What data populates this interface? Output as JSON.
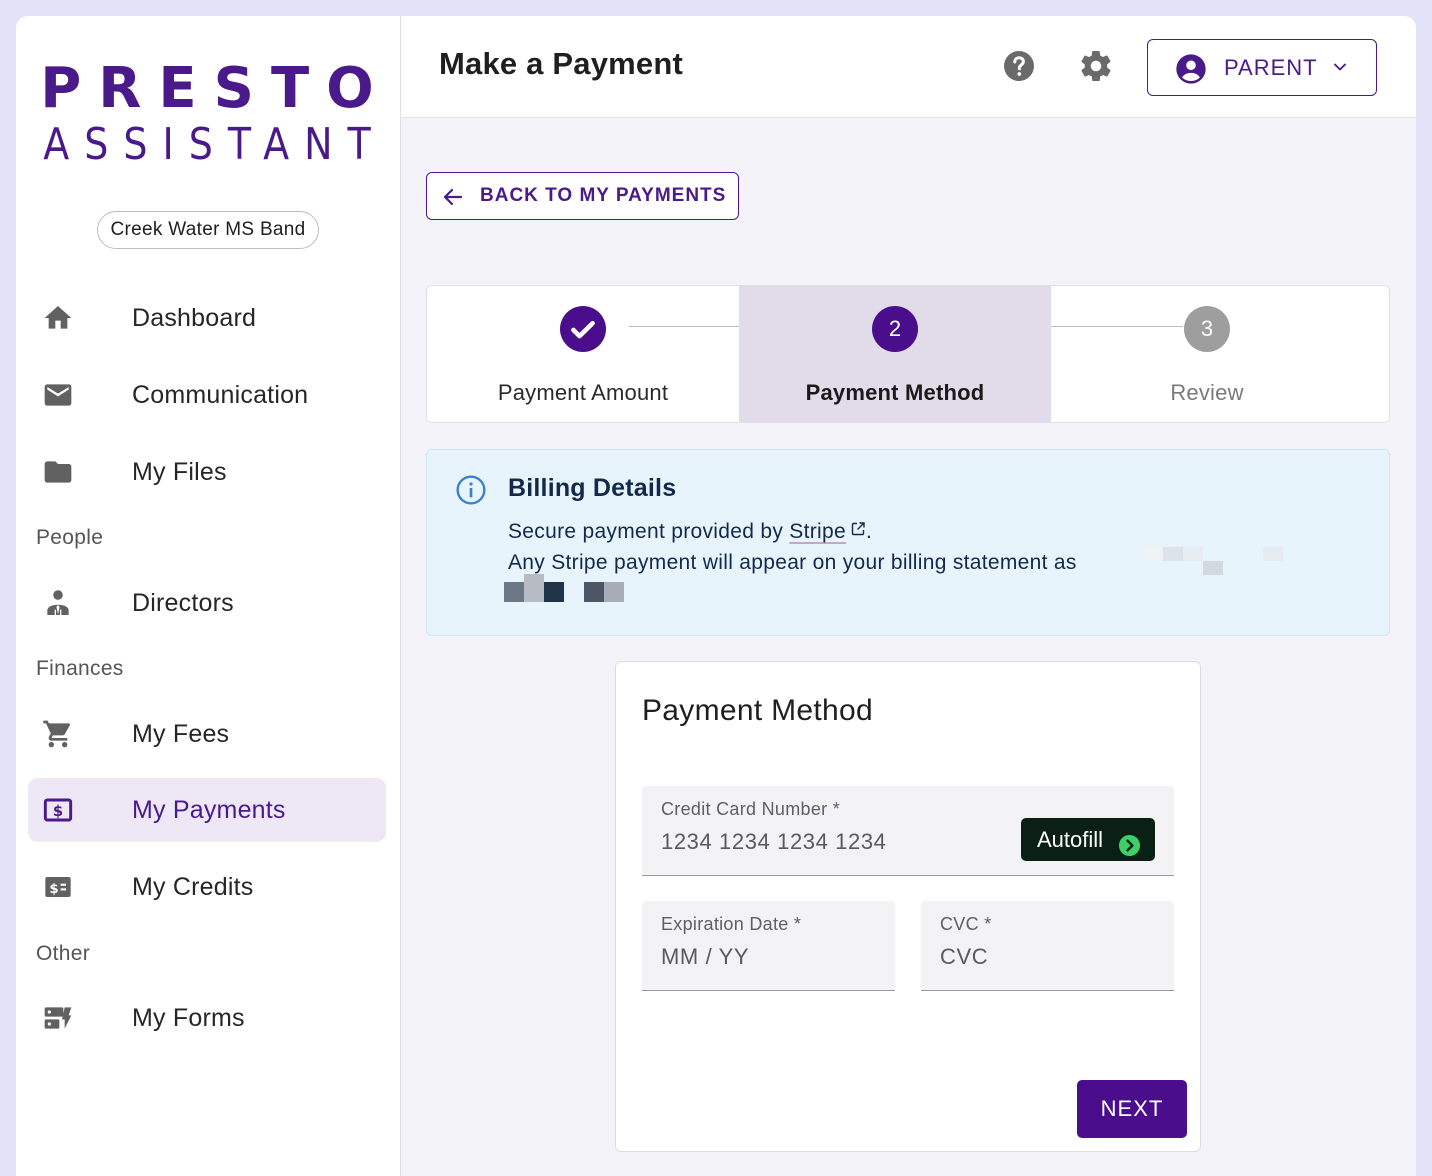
{
  "logo": {
    "line1": "PRESTO",
    "line2": "ASSISTANT"
  },
  "organization": "Creek Water MS Band",
  "nav": {
    "dashboard": "Dashboard",
    "communication": "Communication",
    "my_files": "My Files",
    "section_people": "People",
    "directors": "Directors",
    "section_finances": "Finances",
    "my_fees": "My Fees",
    "my_payments": "My Payments",
    "my_credits": "My Credits",
    "section_other": "Other",
    "my_forms": "My Forms",
    "active_item": "My Payments"
  },
  "header": {
    "title": "Make a Payment",
    "help_icon": "help-circle-icon",
    "settings_icon": "gear-icon",
    "user_role": "PARENT"
  },
  "back_button": "BACK TO MY PAYMENTS",
  "stepper": {
    "steps": [
      {
        "number": "1",
        "label": "Payment Amount",
        "status": "completed"
      },
      {
        "number": "2",
        "label": "Payment Method",
        "status": "active"
      },
      {
        "number": "3",
        "label": "Review",
        "status": "pending"
      }
    ]
  },
  "billing": {
    "title": "Billing Details",
    "line1_prefix": "Secure payment provided by ",
    "line1_link": "Stripe",
    "line1_suffix": ".",
    "line2": "Any Stripe payment will appear on your billing statement as"
  },
  "payment_form": {
    "title": "Payment Method",
    "card_number_label": "Credit Card Number *",
    "card_number_placeholder": "1234 1234 1234 1234",
    "autofill_label": "Autofill",
    "expiration_label": "Expiration Date *",
    "expiration_placeholder": "MM / YY",
    "cvc_label": "CVC *",
    "cvc_placeholder": "CVC",
    "next_label": "NEXT"
  },
  "colors": {
    "brand_purple": "#4a1a8a",
    "button_purple": "#4a0e8c",
    "active_nav_bg": "#ede7f6",
    "active_step_bg": "#e2dbe9",
    "info_bg": "#e8f4fc",
    "autofill_bg": "#0a2014",
    "autofill_accent": "#3ecf6a"
  }
}
